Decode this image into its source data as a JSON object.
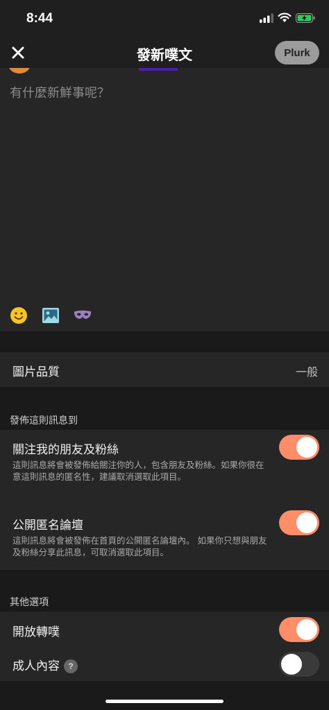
{
  "status_bar": {
    "time": "8:44",
    "icons": [
      "signal-icon",
      "wifi-icon",
      "battery-charging-icon"
    ]
  },
  "navbar": {
    "title": "發新噗文",
    "submit_label": "Plurk",
    "close_icon": "close-icon"
  },
  "composer": {
    "placeholder": "有什麼新鮮事呢？",
    "tools": [
      "emoji-icon",
      "image-icon",
      "mask-icon"
    ]
  },
  "image_quality": {
    "label": "圖片品質",
    "value": "一般"
  },
  "publish_section": {
    "header": "發佈這則訊息到",
    "items": [
      {
        "label": "關注我的朋友及粉絲",
        "description": "這則訊息將會被發佈給關注你的人，包含朋友及粉絲。如果你很在意這則訊息的匿名性，建議取消選取此項目。",
        "enabled": true
      },
      {
        "label": "公開匿名論壇",
        "description": "這則訊息將會被發佈在首頁的公開匿名論壇內。 如果你只想與朋友及粉絲分享此訊息，可取消選取此項目。",
        "enabled": true
      }
    ]
  },
  "other_section": {
    "header": "其他選項",
    "items": [
      {
        "label": "開放轉噗",
        "enabled": true
      },
      {
        "label": "成人內容",
        "help": "?",
        "enabled": false
      }
    ]
  },
  "colors": {
    "accent": "#ff8d68",
    "background": "#1a1a1a",
    "panel": "#262626"
  }
}
